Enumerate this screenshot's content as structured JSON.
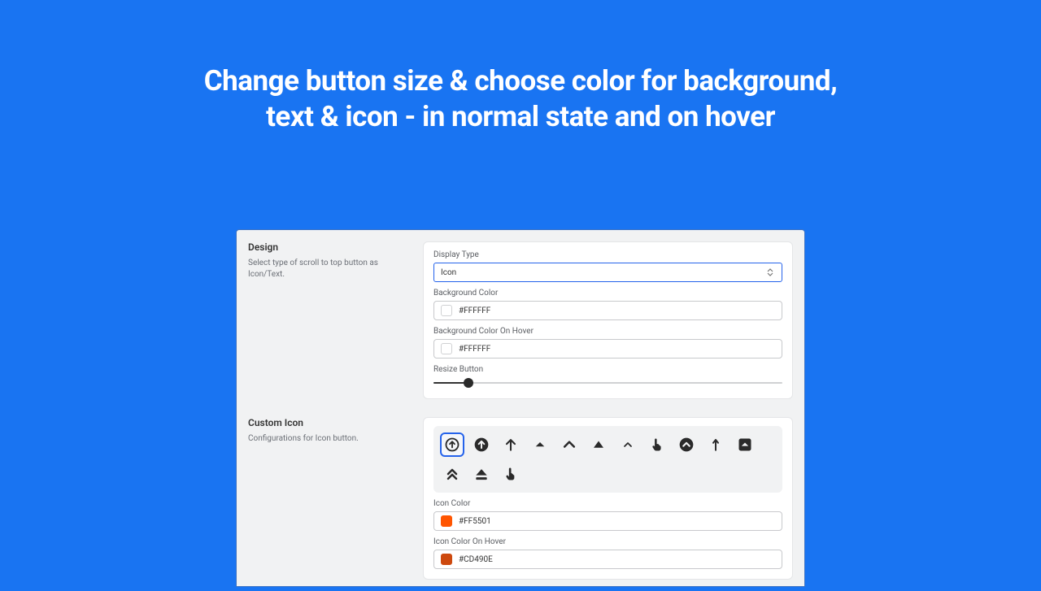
{
  "hero": {
    "line1": "Change button size & choose color for background,",
    "line2": "text & icon - in normal state and on hover"
  },
  "design": {
    "title": "Design",
    "desc": "Select type of scroll to top button as Icon/Text.",
    "displayTypeLabel": "Display Type",
    "displayTypeValue": "Icon",
    "bgColorLabel": "Background Color",
    "bgColorValue": "#FFFFFF",
    "bgHoverLabel": "Background Color On Hover",
    "bgHoverValue": "#FFFFFF",
    "resizeLabel": "Resize Button"
  },
  "customIcon": {
    "title": "Custom Icon",
    "desc": "Configurations for Icon button.",
    "icons": [
      "circle-arrow-up-outline",
      "circle-arrow-up-fill",
      "arrow-up",
      "triangle-up-small",
      "chevron-up",
      "triangle-up",
      "chevron-up-small",
      "hand-pointer-up",
      "circle-chevron-up",
      "arrow-up-thin",
      "square-caret-up",
      "double-chevron-up",
      "eject",
      "hand-point-up-solid"
    ],
    "selected": "circle-arrow-up-outline",
    "iconColorLabel": "Icon Color",
    "iconColorValue": "#FF5501",
    "iconHoverLabel": "Icon Color On Hover",
    "iconHoverValue": "#CD490E"
  }
}
